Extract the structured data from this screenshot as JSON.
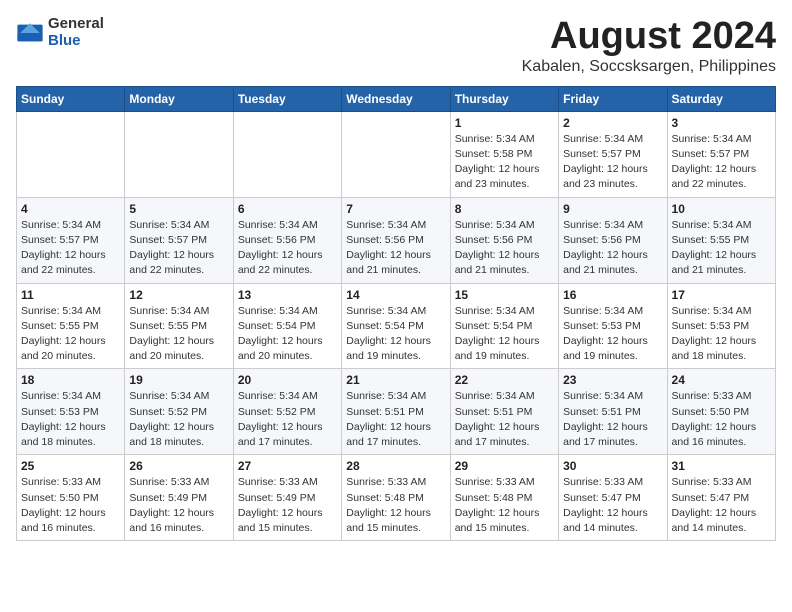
{
  "header": {
    "logo_general": "General",
    "logo_blue": "Blue",
    "month_title": "August 2024",
    "location": "Kabalen, Soccsksargen, Philippines"
  },
  "calendar": {
    "days_of_week": [
      "Sunday",
      "Monday",
      "Tuesday",
      "Wednesday",
      "Thursday",
      "Friday",
      "Saturday"
    ],
    "weeks": [
      [
        {
          "day": "",
          "sunrise": "",
          "sunset": "",
          "daylight": ""
        },
        {
          "day": "",
          "sunrise": "",
          "sunset": "",
          "daylight": ""
        },
        {
          "day": "",
          "sunrise": "",
          "sunset": "",
          "daylight": ""
        },
        {
          "day": "",
          "sunrise": "",
          "sunset": "",
          "daylight": ""
        },
        {
          "day": "1",
          "sunrise": "Sunrise: 5:34 AM",
          "sunset": "Sunset: 5:58 PM",
          "daylight": "Daylight: 12 hours and 23 minutes."
        },
        {
          "day": "2",
          "sunrise": "Sunrise: 5:34 AM",
          "sunset": "Sunset: 5:57 PM",
          "daylight": "Daylight: 12 hours and 23 minutes."
        },
        {
          "day": "3",
          "sunrise": "Sunrise: 5:34 AM",
          "sunset": "Sunset: 5:57 PM",
          "daylight": "Daylight: 12 hours and 22 minutes."
        }
      ],
      [
        {
          "day": "4",
          "sunrise": "Sunrise: 5:34 AM",
          "sunset": "Sunset: 5:57 PM",
          "daylight": "Daylight: 12 hours and 22 minutes."
        },
        {
          "day": "5",
          "sunrise": "Sunrise: 5:34 AM",
          "sunset": "Sunset: 5:57 PM",
          "daylight": "Daylight: 12 hours and 22 minutes."
        },
        {
          "day": "6",
          "sunrise": "Sunrise: 5:34 AM",
          "sunset": "Sunset: 5:56 PM",
          "daylight": "Daylight: 12 hours and 22 minutes."
        },
        {
          "day": "7",
          "sunrise": "Sunrise: 5:34 AM",
          "sunset": "Sunset: 5:56 PM",
          "daylight": "Daylight: 12 hours and 21 minutes."
        },
        {
          "day": "8",
          "sunrise": "Sunrise: 5:34 AM",
          "sunset": "Sunset: 5:56 PM",
          "daylight": "Daylight: 12 hours and 21 minutes."
        },
        {
          "day": "9",
          "sunrise": "Sunrise: 5:34 AM",
          "sunset": "Sunset: 5:56 PM",
          "daylight": "Daylight: 12 hours and 21 minutes."
        },
        {
          "day": "10",
          "sunrise": "Sunrise: 5:34 AM",
          "sunset": "Sunset: 5:55 PM",
          "daylight": "Daylight: 12 hours and 21 minutes."
        }
      ],
      [
        {
          "day": "11",
          "sunrise": "Sunrise: 5:34 AM",
          "sunset": "Sunset: 5:55 PM",
          "daylight": "Daylight: 12 hours and 20 minutes."
        },
        {
          "day": "12",
          "sunrise": "Sunrise: 5:34 AM",
          "sunset": "Sunset: 5:55 PM",
          "daylight": "Daylight: 12 hours and 20 minutes."
        },
        {
          "day": "13",
          "sunrise": "Sunrise: 5:34 AM",
          "sunset": "Sunset: 5:54 PM",
          "daylight": "Daylight: 12 hours and 20 minutes."
        },
        {
          "day": "14",
          "sunrise": "Sunrise: 5:34 AM",
          "sunset": "Sunset: 5:54 PM",
          "daylight": "Daylight: 12 hours and 19 minutes."
        },
        {
          "day": "15",
          "sunrise": "Sunrise: 5:34 AM",
          "sunset": "Sunset: 5:54 PM",
          "daylight": "Daylight: 12 hours and 19 minutes."
        },
        {
          "day": "16",
          "sunrise": "Sunrise: 5:34 AM",
          "sunset": "Sunset: 5:53 PM",
          "daylight": "Daylight: 12 hours and 19 minutes."
        },
        {
          "day": "17",
          "sunrise": "Sunrise: 5:34 AM",
          "sunset": "Sunset: 5:53 PM",
          "daylight": "Daylight: 12 hours and 18 minutes."
        }
      ],
      [
        {
          "day": "18",
          "sunrise": "Sunrise: 5:34 AM",
          "sunset": "Sunset: 5:53 PM",
          "daylight": "Daylight: 12 hours and 18 minutes."
        },
        {
          "day": "19",
          "sunrise": "Sunrise: 5:34 AM",
          "sunset": "Sunset: 5:52 PM",
          "daylight": "Daylight: 12 hours and 18 minutes."
        },
        {
          "day": "20",
          "sunrise": "Sunrise: 5:34 AM",
          "sunset": "Sunset: 5:52 PM",
          "daylight": "Daylight: 12 hours and 17 minutes."
        },
        {
          "day": "21",
          "sunrise": "Sunrise: 5:34 AM",
          "sunset": "Sunset: 5:51 PM",
          "daylight": "Daylight: 12 hours and 17 minutes."
        },
        {
          "day": "22",
          "sunrise": "Sunrise: 5:34 AM",
          "sunset": "Sunset: 5:51 PM",
          "daylight": "Daylight: 12 hours and 17 minutes."
        },
        {
          "day": "23",
          "sunrise": "Sunrise: 5:34 AM",
          "sunset": "Sunset: 5:51 PM",
          "daylight": "Daylight: 12 hours and 17 minutes."
        },
        {
          "day": "24",
          "sunrise": "Sunrise: 5:33 AM",
          "sunset": "Sunset: 5:50 PM",
          "daylight": "Daylight: 12 hours and 16 minutes."
        }
      ],
      [
        {
          "day": "25",
          "sunrise": "Sunrise: 5:33 AM",
          "sunset": "Sunset: 5:50 PM",
          "daylight": "Daylight: 12 hours and 16 minutes."
        },
        {
          "day": "26",
          "sunrise": "Sunrise: 5:33 AM",
          "sunset": "Sunset: 5:49 PM",
          "daylight": "Daylight: 12 hours and 16 minutes."
        },
        {
          "day": "27",
          "sunrise": "Sunrise: 5:33 AM",
          "sunset": "Sunset: 5:49 PM",
          "daylight": "Daylight: 12 hours and 15 minutes."
        },
        {
          "day": "28",
          "sunrise": "Sunrise: 5:33 AM",
          "sunset": "Sunset: 5:48 PM",
          "daylight": "Daylight: 12 hours and 15 minutes."
        },
        {
          "day": "29",
          "sunrise": "Sunrise: 5:33 AM",
          "sunset": "Sunset: 5:48 PM",
          "daylight": "Daylight: 12 hours and 15 minutes."
        },
        {
          "day": "30",
          "sunrise": "Sunrise: 5:33 AM",
          "sunset": "Sunset: 5:47 PM",
          "daylight": "Daylight: 12 hours and 14 minutes."
        },
        {
          "day": "31",
          "sunrise": "Sunrise: 5:33 AM",
          "sunset": "Sunset: 5:47 PM",
          "daylight": "Daylight: 12 hours and 14 minutes."
        }
      ]
    ]
  }
}
